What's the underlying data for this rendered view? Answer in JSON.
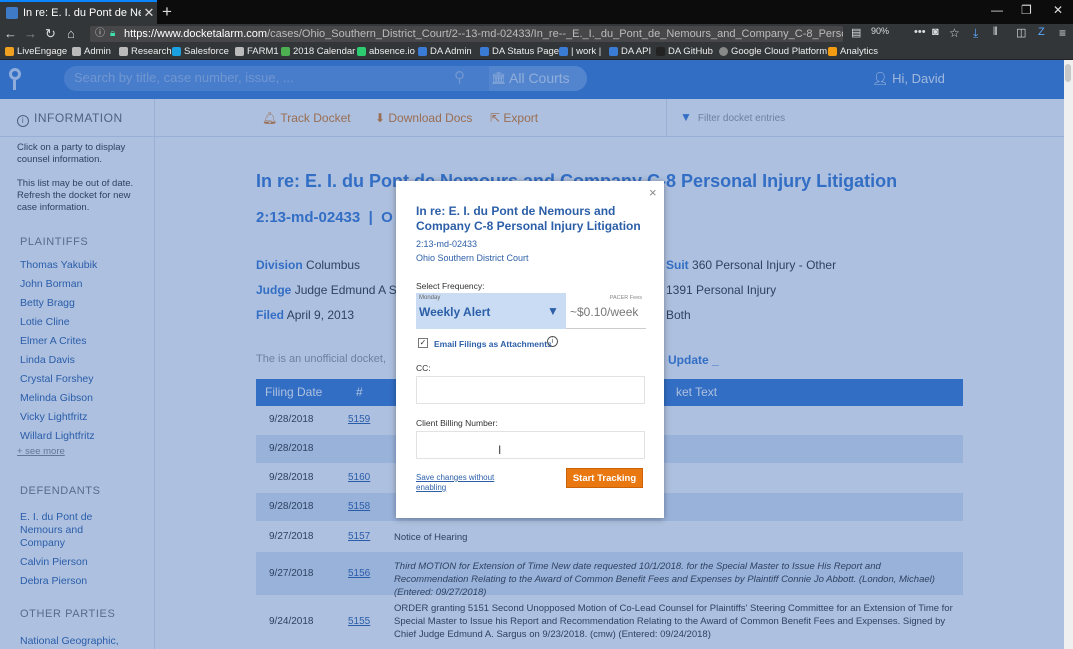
{
  "browser": {
    "tab_title": "In re: E. I. du Pont de Nemours",
    "tab_close": "✕",
    "new_tab": "+",
    "url_host": "https://www.docketalarm.com",
    "url_path": "/cases/Ohio_Southern_District_Court/2--13-md-02433/In_re--_E._I._du_Pont_de_Nemours_and_Company_C-8_Personal_Injury_Litig...",
    "zoom": "90%",
    "bookmarks": [
      "LiveEngage",
      "Admin",
      "Research",
      "Salesforce",
      "FARM1",
      "2018 Calendar",
      "absence.io",
      "DA Admin",
      "DA Status Page",
      "| work |",
      "DA API",
      "DA GitHub",
      "Google Cloud Platform",
      "Analytics"
    ]
  },
  "header": {
    "search_placeholder": "Search by title, case number, issue, ...",
    "court_filter": "All Courts",
    "greeting": "Hi, David"
  },
  "sidebar": {
    "info_heading": "INFORMATION",
    "info_text_1": "Click on a party to display counsel information.",
    "info_text_2": "This list may be out of date. Refresh the docket for new case information.",
    "plaintiffs_heading": "PLAINTIFFS",
    "plaintiffs": [
      "Thomas Yakubik",
      "John Borman",
      "Betty Bragg",
      "Lotie Cline",
      "Elmer A Crites",
      "Linda Davis",
      "Crystal Forshey",
      "Melinda Gibson",
      "Vicky Lightfritz",
      "Willard Lightfritz"
    ],
    "see_more": "+ see more",
    "defendants_heading": "DEFENDANTS",
    "defendants": [
      "E. I. du Pont de Nemours and Company",
      "Calvin Pierson",
      "Debra Pierson"
    ],
    "other_heading": "OTHER PARTIES",
    "other_parties": [
      "National Geographic, Interested Party"
    ]
  },
  "toolbar": {
    "track": "Track Docket",
    "download": "Download Docs",
    "export": "Export",
    "filter_placeholder": "Filter docket entries"
  },
  "case": {
    "title": "In re: E. I. du Pont de Nemours and Company C-8 Personal Injury Litigation",
    "number": "2:13-md-02433",
    "sep": "|",
    "court_initial": "O",
    "division_label": "Division",
    "division": "Columbus",
    "judge_label": "Judge",
    "judge": "Judge Edmund A Sa",
    "filed_label": "Filed",
    "filed": "April 9, 2013",
    "suit_label": "Suit",
    "suit": "360 Personal Injury - Other",
    "cause": "1391 Personal Injury",
    "jury": "Both",
    "unofficial": "The is an unofficial docket,",
    "update": "Update _"
  },
  "table": {
    "headers": [
      "Filing Date",
      "#",
      "ket Text"
    ],
    "rows": [
      {
        "date": "9/28/2018",
        "num": "5159",
        "text": ""
      },
      {
        "date": "9/28/2018",
        "num": "",
        "text": ""
      },
      {
        "date": "9/28/2018",
        "num": "5160",
        "text": ""
      },
      {
        "date": "9/28/2018",
        "num": "5158",
        "text": ""
      },
      {
        "date": "9/27/2018",
        "num": "5157",
        "text": "Notice of Hearing"
      },
      {
        "date": "9/27/2018",
        "num": "5156",
        "text": "Third MOTION for Extension of Time New date requested 10/1/2018. for the Special Master to Issue His Report and Recommendation Relating to the Award of Common Benefit Fees and Expenses by Plaintiff Connie Jo Abbott. (London, Michael) (Entered: 09/27/2018)"
      },
      {
        "date": "9/24/2018",
        "num": "5155",
        "text": "ORDER granting 5151 Second Unopposed Motion of Co-Lead Counsel for Plaintiffs' Steering Committee for an Extension of Time for Special Master to Issue his Report and Recommendation Relating to the Award of Common Benefit Fees and Expenses. Signed by Chief Judge Edmund A. Sargus on 9/23/2018. (cmw) (Entered: 09/24/2018)"
      }
    ]
  },
  "modal": {
    "close": "×",
    "title": "In re: E. I. du Pont de Nemours and Company C-8 Personal Injury Litigation",
    "case_number": "2:13-md-02433",
    "court": "Ohio Southern District Court",
    "frequency_label": "Select Frequency:",
    "frequency_small": "Monday",
    "frequency_value": "Weekly Alert",
    "fee_label": "PACER Fees",
    "fee_value": "~$0.10/week",
    "email_check": "✓",
    "email_label": "Email Filings as Attachments",
    "cc_label": "CC:",
    "billing_label": "Client Billing Number:",
    "save_link": "Save changes without enabling",
    "start_button": "Start Tracking"
  }
}
